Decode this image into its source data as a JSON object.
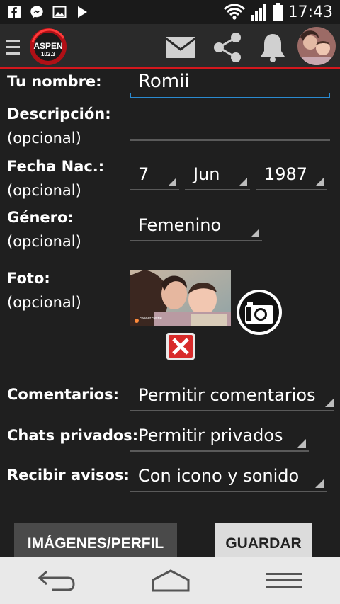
{
  "status_bar": {
    "time": "17:43",
    "icons": [
      "facebook-icon",
      "messenger-icon",
      "image-icon",
      "play-icon",
      "wifi-icon",
      "signal-icon",
      "battery-icon"
    ]
  },
  "app_bar": {
    "logo_text": "ASPEN",
    "logo_freq": "102.3",
    "icons": [
      "menu-icon",
      "mail-icon",
      "share-icon",
      "bell-icon",
      "avatar"
    ]
  },
  "form": {
    "name_label": "Tu nombre:",
    "name_value": "Romii",
    "description_label": "Descripción:",
    "description_optional": "(opcional)",
    "description_value": "",
    "birth_label": "Fecha Nac.:",
    "birth_optional": "(opcional)",
    "birth_day": "7",
    "birth_month": "Jun",
    "birth_year": "1987",
    "gender_label": "Género:",
    "gender_optional": "(opcional)",
    "gender_value": "Femenino",
    "photo_label": "Foto:",
    "photo_optional": "(opcional)",
    "photo_caption": "Sweet Selfie",
    "comments_label": "Comentarios:",
    "comments_value": "Permitir comentarios",
    "chats_label": "Chats privados:",
    "chats_value": "Permitir privados",
    "notices_label": "Recibir avisos:",
    "notices_value": "Con icono y sonido"
  },
  "buttons": {
    "images_profile": "IMÁGENES/PERFIL",
    "save": "GUARDAR"
  },
  "colors": {
    "accent_red": "#d4171d",
    "focus_blue": "#2a8ad0",
    "background": "#1f1f1f"
  }
}
